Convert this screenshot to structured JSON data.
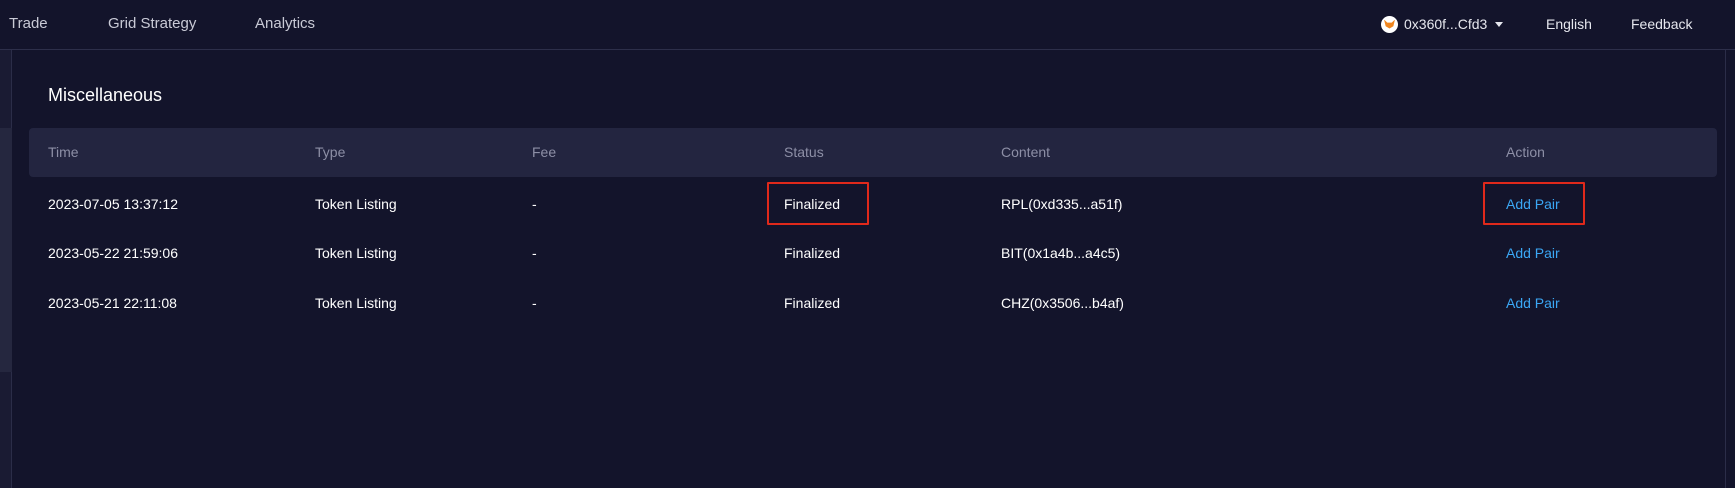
{
  "nav": {
    "trade": "Trade",
    "grid_strategy": "Grid Strategy",
    "analytics": "Analytics",
    "wallet_address": "0x360f...Cfd3",
    "wallet_icon": "metamask-fox-icon",
    "language": "English",
    "feedback": "Feedback"
  },
  "section": {
    "title": "Miscellaneous"
  },
  "table": {
    "headers": {
      "time": "Time",
      "type": "Type",
      "fee": "Fee",
      "status": "Status",
      "content": "Content",
      "action": "Action"
    },
    "rows": [
      {
        "time": "2023-07-05 13:37:12",
        "type": "Token Listing",
        "fee": "-",
        "status": "Finalized",
        "content": "RPL(0xd335...a51f)",
        "action": "Add Pair"
      },
      {
        "time": "2023-05-22 21:59:06",
        "type": "Token Listing",
        "fee": "-",
        "status": "Finalized",
        "content": "BIT(0x1a4b...a4c5)",
        "action": "Add Pair"
      },
      {
        "time": "2023-05-21 22:11:08",
        "type": "Token Listing",
        "fee": "-",
        "status": "Finalized",
        "content": "CHZ(0x3506...b4af)",
        "action": "Add Pair"
      }
    ]
  },
  "colors": {
    "background": "#13142b",
    "header_row": "#232540",
    "link": "#3ba7f5",
    "highlight": "#e0291b"
  }
}
